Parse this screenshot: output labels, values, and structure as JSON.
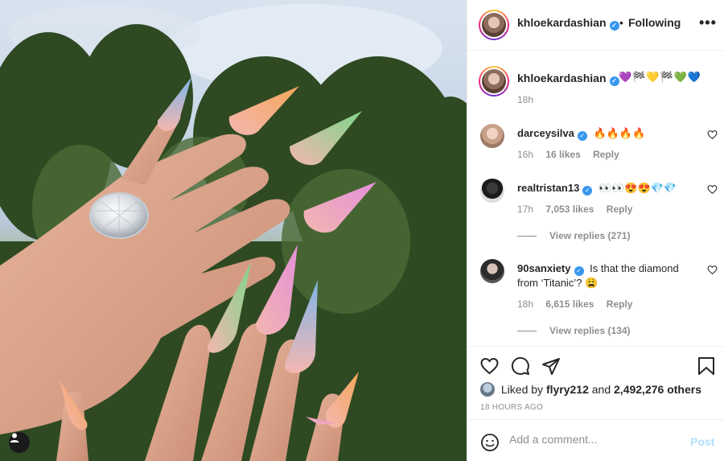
{
  "post": {
    "author": "khloekardashian",
    "header_separator": "•",
    "follow_status": "Following",
    "more_icon": "more-horizontal-icon",
    "caption_emojis": "💜🏁💛🏁💚💙",
    "caption_time": "18h"
  },
  "comments": [
    {
      "username": "darceysilva",
      "verified": true,
      "text": "🔥🔥🔥🔥",
      "time": "16h",
      "likes": "16 likes",
      "reply": "Reply",
      "view_replies": ""
    },
    {
      "username": "realtristan13",
      "verified": true,
      "text": "👀👀😍😍💎💎",
      "time": "17h",
      "likes": "7,053 likes",
      "reply": "Reply",
      "view_replies": "View replies (271)"
    },
    {
      "username": "90sanxiety",
      "verified": true,
      "text": "Is that the diamond from ‘Titanic’? 😩",
      "time": "18h",
      "likes": "6,615 likes",
      "reply": "Reply",
      "view_replies": "View replies (134)"
    }
  ],
  "likes": {
    "prefix": "Liked by",
    "user": "flyry212",
    "joiner": "and",
    "others": "2,492,276 others"
  },
  "timestamp": "18 HOURS AGO",
  "add_comment": {
    "placeholder": "Add a comment...",
    "post_label": "Post"
  },
  "colors": {
    "verified": "#3897f0",
    "post_disabled": "#b2dffc",
    "secondary_text": "#8e8e8e"
  }
}
